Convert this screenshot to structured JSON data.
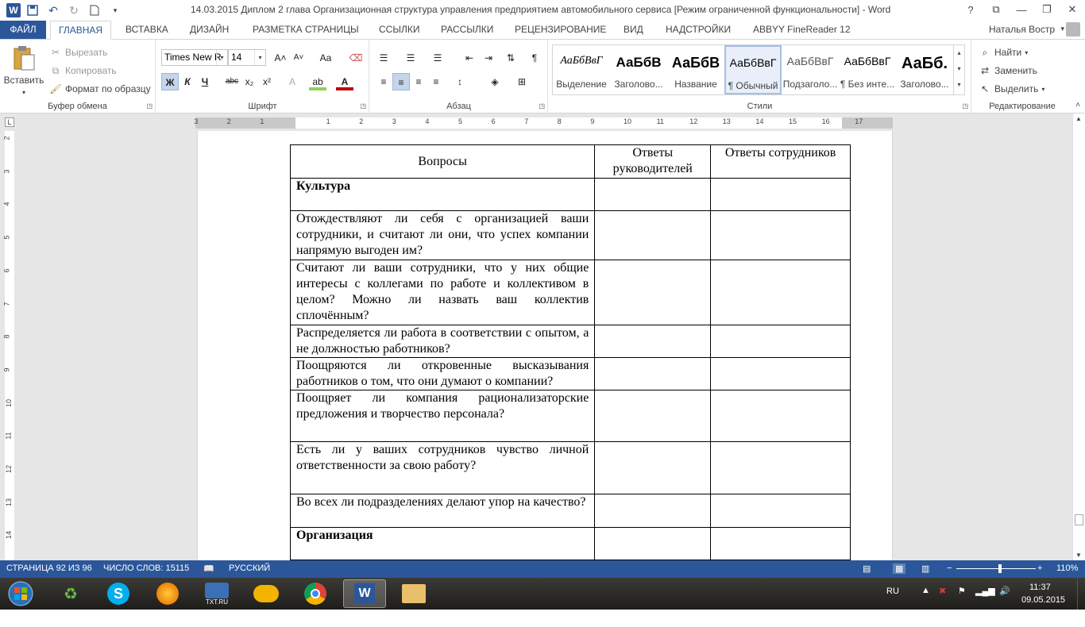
{
  "titlebar": {
    "title": "14.03.2015 Диплом 2 глава Организационная структура управления предприятием автомобильного сервиса [Режим ограниченной функциональности] - Word",
    "help": "?",
    "restore": "⧉",
    "minimize": "—",
    "maximize": "❐",
    "close": "✕"
  },
  "tabs": {
    "file": "ФАЙЛ",
    "home": "ГЛАВНАЯ",
    "insert": "ВСТАВКА",
    "design": "ДИЗАЙН",
    "layout": "РАЗМЕТКА СТРАНИЦЫ",
    "references": "ССЫЛКИ",
    "mailings": "РАССЫЛКИ",
    "review": "РЕЦЕНЗИРОВАНИЕ",
    "view": "ВИД",
    "addins": "НАДСТРОЙКИ",
    "abbyy": "ABBYY FineReader 12",
    "user": "Наталья Востр"
  },
  "clipboard": {
    "paste": "Вставить",
    "cut": "Вырезать",
    "copy": "Копировать",
    "format_painter": "Формат по образцу",
    "label": "Буфер обмена"
  },
  "font": {
    "family": "Times New R",
    "size": "14",
    "label": "Шрифт",
    "bold": "Ж",
    "italic": "К",
    "underline": "Ч",
    "strike": "abc",
    "sub": "x₂",
    "sup": "x²",
    "grow": "A˄",
    "shrink": "A˅",
    "case": "Aa"
  },
  "paragraph": {
    "label": "Абзац"
  },
  "styles": {
    "label": "Стили",
    "items": [
      {
        "preview": "АаБбВвГ",
        "name": "Выделение"
      },
      {
        "preview": "АаБбВ",
        "name": "Заголово..."
      },
      {
        "preview": "АаБбВ",
        "name": "Название"
      },
      {
        "preview": "АаБбВвГ",
        "name": "¶ Обычный"
      },
      {
        "preview": "АаБбВвГ",
        "name": "Подзаголо..."
      },
      {
        "preview": "АаБбВвГ",
        "name": "¶ Без инте..."
      },
      {
        "preview": "АаБб.",
        "name": "Заголово..."
      }
    ]
  },
  "editing": {
    "find": "Найти",
    "replace": "Заменить",
    "select": "Выделить",
    "label": "Редактирование"
  },
  "ruler": {
    "h": [
      "3",
      "2",
      "1",
      "1",
      "2",
      "3",
      "4",
      "5",
      "6",
      "7",
      "8",
      "9",
      "10",
      "11",
      "12",
      "13",
      "14",
      "15",
      "16",
      "17"
    ],
    "v": [
      "2",
      "3",
      "4",
      "5",
      "6",
      "7",
      "8",
      "9",
      "10",
      "11",
      "12",
      "13",
      "14"
    ]
  },
  "table": {
    "headers": [
      "Вопросы",
      "Ответы руководителей",
      "Ответы сотрудников"
    ],
    "rows": [
      "Культура",
      "Отождествляют ли себя с организацией ваши сотрудники, и считают ли они, что успех компании напрямую выгоден им?",
      "Считают ли ваши сотрудники, что у них общие интересы с коллегами по работе и коллективом в целом? Можно ли назвать ваш коллектив сплочённым?",
      "Распределяется ли работа в соответствии с опытом, а не должностью работников?",
      "Поощряются ли откровенные высказывания работников о том, что они думают о компании?",
      "Поощряет ли компания рационализаторские предложения и творчество персонала?",
      "Есть ли у ваших сотрудников чувство личной ответственности за свою работу?",
      "Во всех ли подразделениях делают упор на качество?",
      "Организация"
    ]
  },
  "status": {
    "page": "СТРАНИЦА 92 ИЗ 96",
    "words": "ЧИСЛО СЛОВ: 15115",
    "lang": "РУССКИЙ",
    "zoom": "110%",
    "zoom_level": 0.55
  },
  "taskbar": {
    "lang": "RU",
    "time": "11:37",
    "date": "09.05.2015",
    "txt_label": "TXT.RU"
  }
}
